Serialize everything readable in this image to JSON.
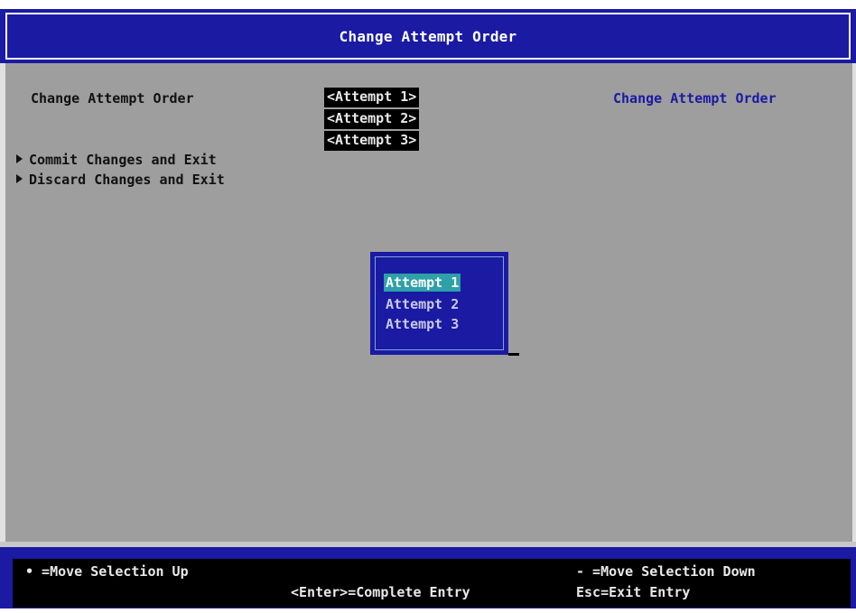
{
  "header": {
    "title": "Change Attempt Order"
  },
  "main": {
    "setting_label": "Change Attempt Order",
    "current_values": [
      "<Attempt 1>",
      "<Attempt 2>",
      "<Attempt 3>"
    ],
    "help_text": "Change Attempt Order",
    "actions": [
      "Commit Changes and Exit",
      "Discard Changes and Exit"
    ]
  },
  "popup": {
    "options": [
      "Attempt 1",
      "Attempt 2",
      "Attempt 3"
    ],
    "selected": "Attempt 1"
  },
  "footer": {
    "move_up": "• =Move Selection Up",
    "move_down": "- =Move Selection Down",
    "enter": "<Enter>=Complete Entry",
    "esc": "Esc=Exit Entry"
  },
  "colors": {
    "header_blue": "#1a1aa3",
    "background_gray": "#9e9e9e",
    "help_text_blue": "#1a1aa3",
    "selection_cyan": "#2ea0a8"
  }
}
